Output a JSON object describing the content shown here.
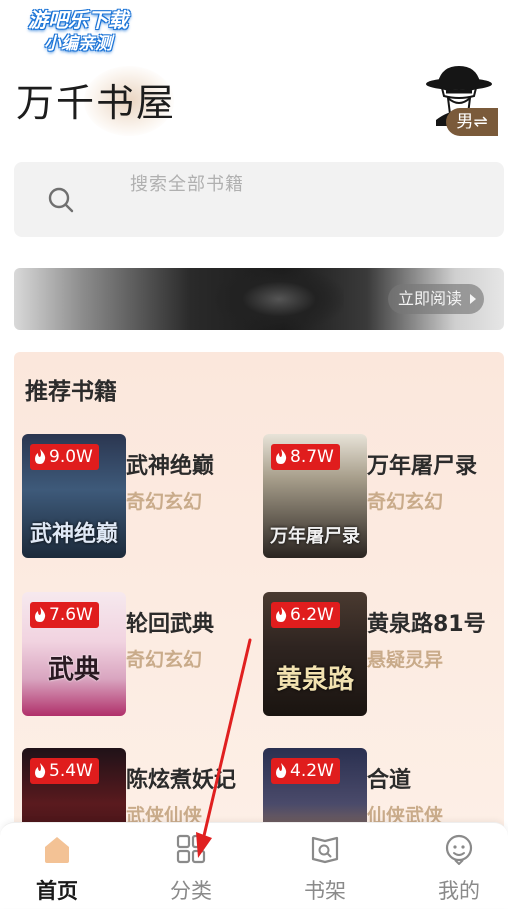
{
  "watermark": {
    "line1": "游吧乐下载",
    "line2": "小编亲测"
  },
  "app": {
    "logo_text": "万千书屋"
  },
  "header": {
    "gender_label": "男⇌"
  },
  "search": {
    "placeholder": "搜索全部书籍"
  },
  "banner": {
    "read_now_label": "立即阅读"
  },
  "recommend": {
    "title": "推荐书籍",
    "books": [
      {
        "name": "武神绝巅",
        "genre": "奇幻玄幻",
        "heat": "9.0W",
        "cover_text": "武神绝巅"
      },
      {
        "name": "万年屠尸录",
        "genre": "奇幻玄幻",
        "heat": "8.7W",
        "cover_text": "万年屠尸录"
      },
      {
        "name": "轮回武典",
        "genre": "奇幻玄幻",
        "heat": "7.6W",
        "cover_text": "武典"
      },
      {
        "name": "黄泉路81号",
        "genre": "悬疑灵异",
        "heat": "6.2W",
        "cover_text": "黄泉路"
      },
      {
        "name": "陈炫煮妖记",
        "genre": "武侠仙侠",
        "heat": "5.4W",
        "cover_text": ""
      },
      {
        "name": "合道",
        "genre": "仙侠武侠",
        "heat": "4.2W",
        "cover_text": ""
      }
    ]
  },
  "tabbar": {
    "items": [
      {
        "label": "首页",
        "icon": "home-icon",
        "active": true
      },
      {
        "label": "分类",
        "icon": "category-grid-icon",
        "active": false
      },
      {
        "label": "书架",
        "icon": "bookshelf-icon",
        "active": false
      },
      {
        "label": "我的",
        "icon": "profile-icon",
        "active": false
      }
    ]
  },
  "colors": {
    "accent": "#f3c295",
    "heat_badge": "#e01d1d",
    "genre_text": "#c9ab8a",
    "annotation_arrow": "#e02020"
  }
}
